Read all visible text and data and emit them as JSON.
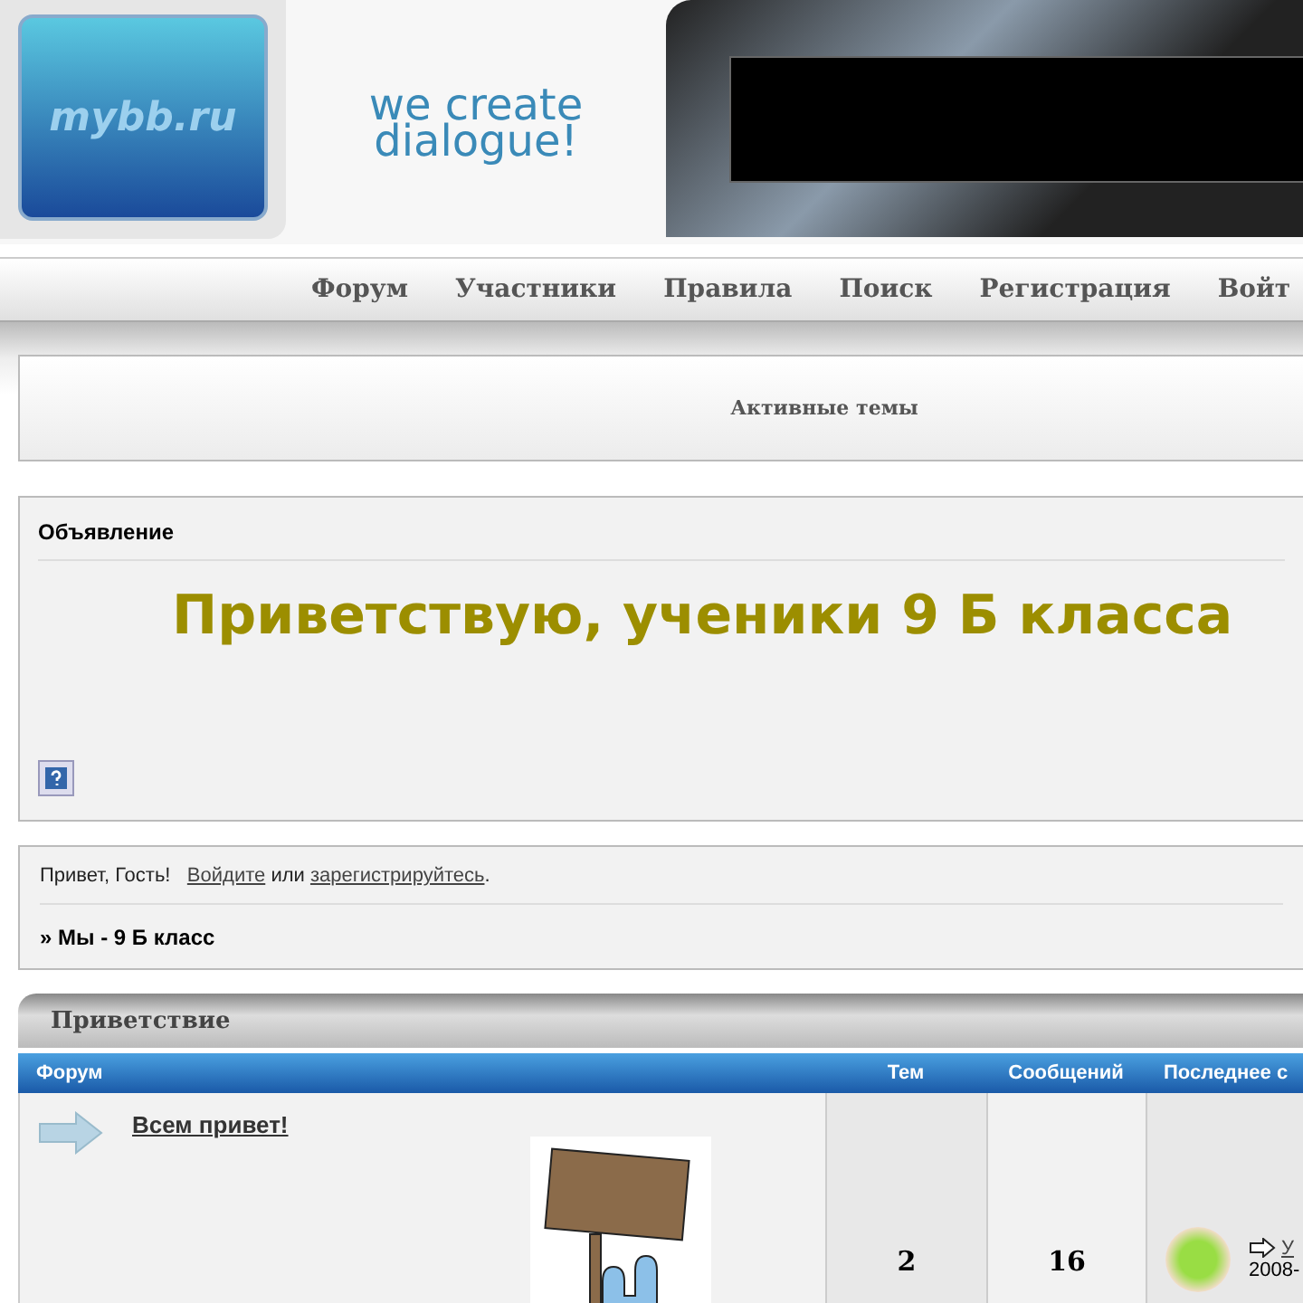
{
  "header": {
    "logo": "mybb.ru",
    "tagline": "we create dialogue!"
  },
  "nav": [
    {
      "label": "Форум"
    },
    {
      "label": "Участники"
    },
    {
      "label": "Правила"
    },
    {
      "label": "Поиск"
    },
    {
      "label": "Регистрация"
    },
    {
      "label": "Войт"
    }
  ],
  "active_topics": "Активные темы",
  "announcement": {
    "title": "Объявление",
    "message": "Приветствую, ученики 9 Б класса"
  },
  "welcome": {
    "greeting": "Привет, Гость!",
    "login_link": "Войдите",
    "or": "или",
    "register_link": "зарегистрируйтесь",
    "period": ".",
    "crumb": "» Мы - 9 Б класс"
  },
  "category": {
    "title": "Приветствие",
    "columns": [
      "Форум",
      "Тем",
      "Сообщений",
      "Последнее с"
    ],
    "rows": [
      {
        "name": "Всем привет!",
        "topics": "2",
        "posts": "16",
        "last_link": "У",
        "last_date": "2008-"
      }
    ]
  }
}
